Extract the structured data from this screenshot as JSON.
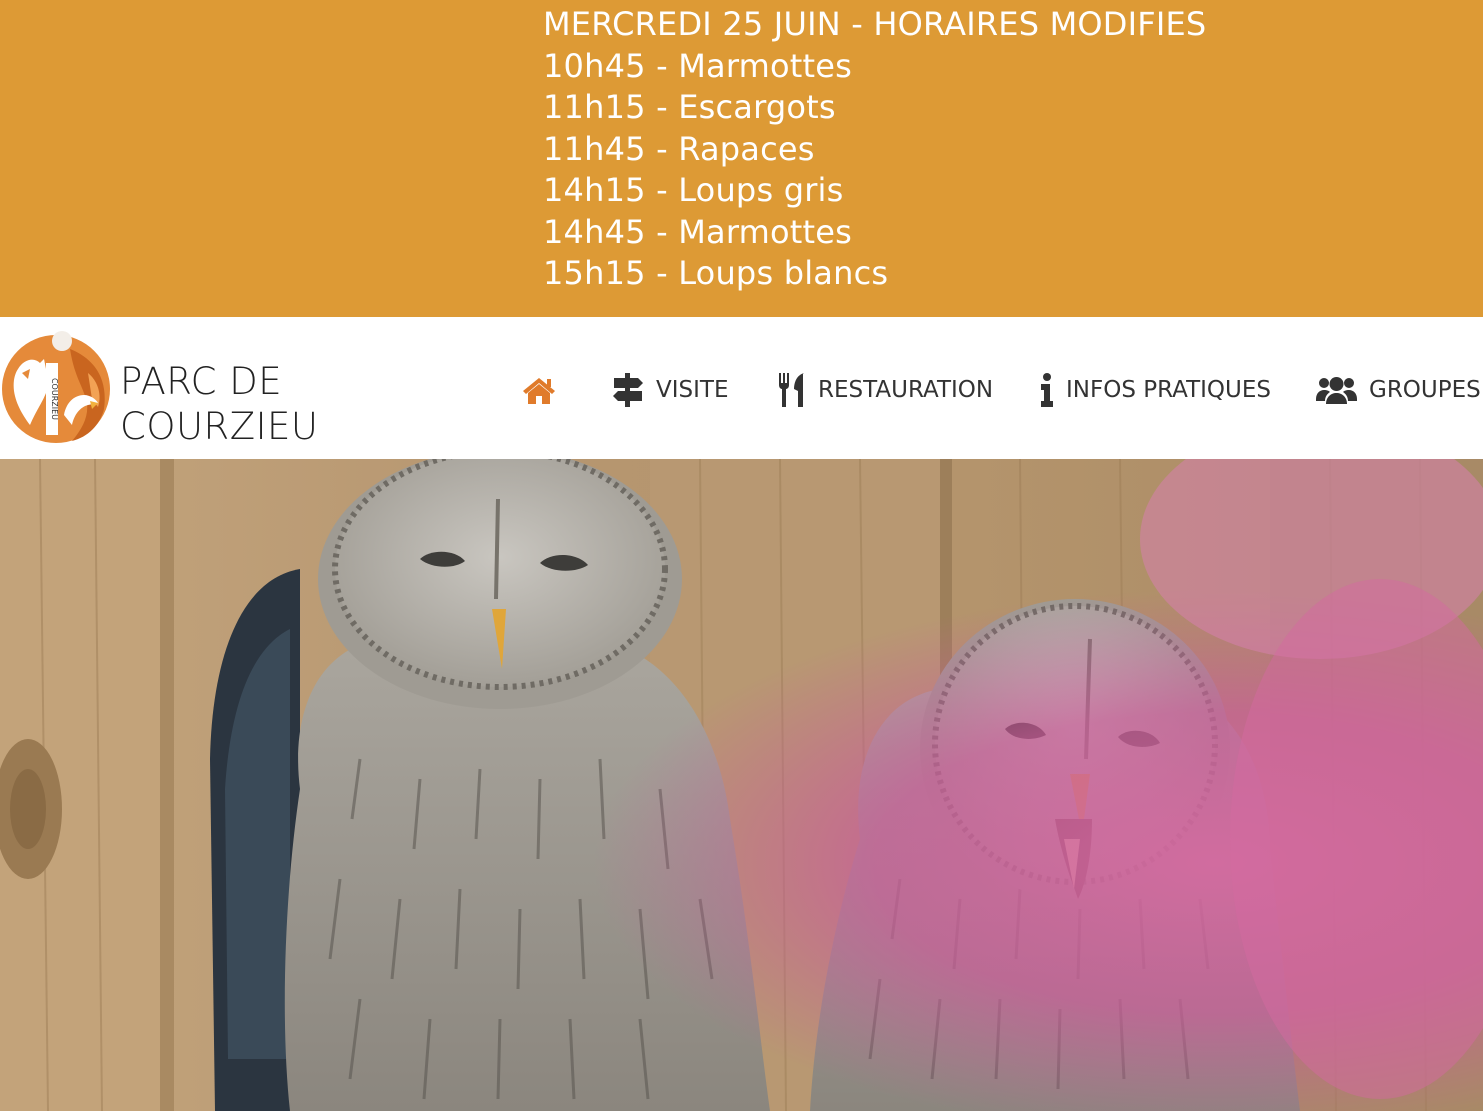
{
  "banner": {
    "lines": [
      "MERCREDI 25 JUIN - HORAIRES MODIFIES",
      "10h45 - Marmottes",
      "11h15 - Escargots",
      "11h45 - Rapaces",
      "14h15 - Loups gris",
      "14h45 - Marmottes",
      "15h15 - Loups blancs"
    ],
    "background": "#dd9a35",
    "text_color": "#ffffff"
  },
  "header": {
    "logo": {
      "line1": "PARC DE",
      "line2": "COURZIEU",
      "mark_text": "COURZIEU"
    },
    "nav": [
      {
        "icon": "home-icon",
        "label": ""
      },
      {
        "icon": "signpost-icon",
        "label": "VISITE"
      },
      {
        "icon": "utensils-icon",
        "label": "RESTAURATION"
      },
      {
        "icon": "info-icon",
        "label": "INFOS PRATIQUES"
      },
      {
        "icon": "users-icon",
        "label": "GROUPES"
      }
    ],
    "accent": "#e07b2b"
  },
  "hero": {
    "subject": "two-owls-photo"
  }
}
